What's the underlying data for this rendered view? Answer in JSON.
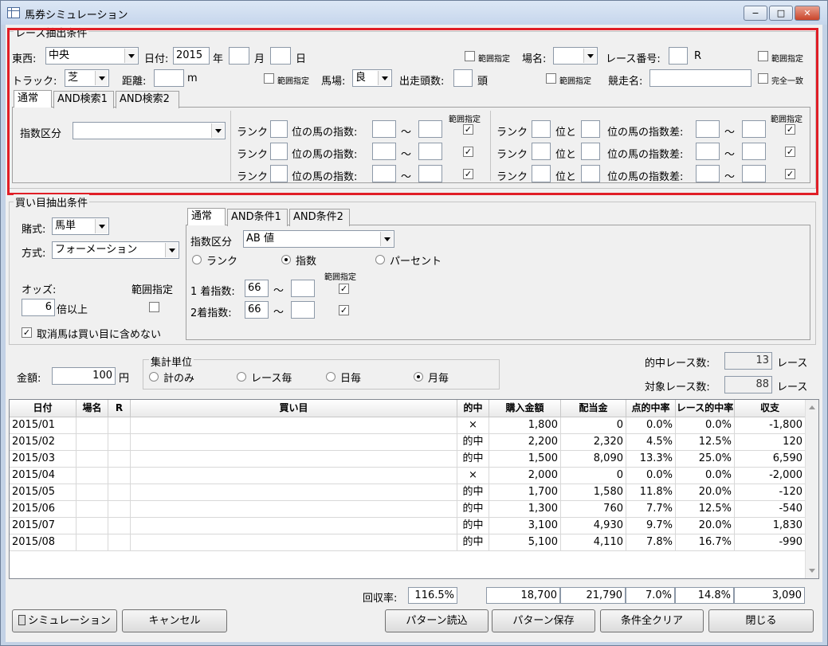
{
  "window": {
    "title": "馬券シミュレーション",
    "min": "−",
    "max": "□",
    "close": "✕"
  },
  "race_filter": {
    "title": "レース抽出条件",
    "east_west_label": "東西:",
    "east_west_value": "中央",
    "date_label": "日付:",
    "year_value": "2015",
    "year_unit": "年",
    "month_value": "",
    "month_unit": "月",
    "day_value": "",
    "day_unit": "日",
    "range_label": "範囲指定",
    "venue_label": "場名:",
    "venue_value": "",
    "race_no_label": "レース番号:",
    "race_no_value": "",
    "race_no_unit": "R",
    "track_label": "トラック:",
    "track_value": "芝",
    "distance_label": "距離:",
    "distance_value": "",
    "distance_unit": "m",
    "going_label": "馬場:",
    "going_value": "良",
    "runners_label": "出走頭数:",
    "runners_value": "",
    "runners_unit": "頭",
    "race_name_label": "競走名:",
    "race_name_value": "",
    "exact_match_label": "完全一致",
    "tabs": [
      "通常",
      "AND検索1",
      "AND検索2"
    ],
    "index_class_label": "指数区分",
    "index_class_value": "",
    "rank_label": "ランク",
    "pos_index_label": "位の馬の指数:",
    "tilde": "〜",
    "rank_and_label": "位と",
    "pos_diff_label": "位の馬の指数差:",
    "check_mark": "✓"
  },
  "bet_filter": {
    "title": "買い目抽出条件",
    "bet_type_label": "賭式:",
    "bet_type_value": "馬単",
    "method_label": "方式:",
    "method_value": "フォーメーション",
    "odds_label": "オッズ:",
    "range_label": "範囲指定",
    "odds_value": "6",
    "odds_unit": "倍以上",
    "exclude_scratched_label": "取消馬は買い目に含めない",
    "tabs": [
      "通常",
      "AND条件1",
      "AND条件2"
    ],
    "index_class_label": "指数区分",
    "index_class_value": "AB 値",
    "radio_rank": "ランク",
    "radio_index": "指数",
    "radio_percent": "パーセント",
    "first_label": "1 着指数:",
    "first_value": "66",
    "second_label": "2着指数:",
    "second_value": "66",
    "tilde": "〜",
    "check_mark": "✓"
  },
  "summary": {
    "amount_label": "金額:",
    "amount_value": "100",
    "amount_unit": "円",
    "unit_group_title": "集計単位",
    "unit_options": [
      "計のみ",
      "レース毎",
      "日毎",
      "月毎"
    ],
    "hit_races_label": "的中レース数:",
    "hit_races_value": "13",
    "races_unit": "レース",
    "target_races_label": "対象レース数:",
    "target_races_value": "88"
  },
  "table": {
    "columns": [
      "日付",
      "場名",
      "R",
      "買い目",
      "的中",
      "購入金額",
      "配当金",
      "点的中率",
      "レース的中率",
      "収支"
    ],
    "rows": [
      [
        "2015/01",
        "",
        "",
        "",
        "×",
        "1,800",
        "0",
        "0.0%",
        "0.0%",
        "-1,800"
      ],
      [
        "2015/02",
        "",
        "",
        "",
        "的中",
        "2,200",
        "2,320",
        "4.5%",
        "12.5%",
        "120"
      ],
      [
        "2015/03",
        "",
        "",
        "",
        "的中",
        "1,500",
        "8,090",
        "13.3%",
        "25.0%",
        "6,590"
      ],
      [
        "2015/04",
        "",
        "",
        "",
        "×",
        "2,000",
        "0",
        "0.0%",
        "0.0%",
        "-2,000"
      ],
      [
        "2015/05",
        "",
        "",
        "",
        "的中",
        "1,700",
        "1,580",
        "11.8%",
        "20.0%",
        "-120"
      ],
      [
        "2015/06",
        "",
        "",
        "",
        "的中",
        "1,300",
        "760",
        "7.7%",
        "12.5%",
        "-540"
      ],
      [
        "2015/07",
        "",
        "",
        "",
        "的中",
        "3,100",
        "4,930",
        "9.7%",
        "20.0%",
        "1,830"
      ],
      [
        "2015/08",
        "",
        "",
        "",
        "的中",
        "5,100",
        "4,110",
        "7.8%",
        "16.7%",
        "-990"
      ]
    ]
  },
  "totals": {
    "recovery_label": "回収率:",
    "recovery_value": "116.5%",
    "purchase": "18,700",
    "payout": "21,790",
    "point_rate": "7.0%",
    "race_rate": "14.8%",
    "balance": "3,090"
  },
  "buttons": {
    "simulation": "シミュレーション",
    "cancel": "キャンセル",
    "load_pattern": "パターン読込",
    "save_pattern": "パターン保存",
    "clear_all": "条件全クリア",
    "close": "閉じる"
  },
  "colors": {
    "highlight": "#e01e26",
    "window_bg": "#f0f0f0"
  }
}
